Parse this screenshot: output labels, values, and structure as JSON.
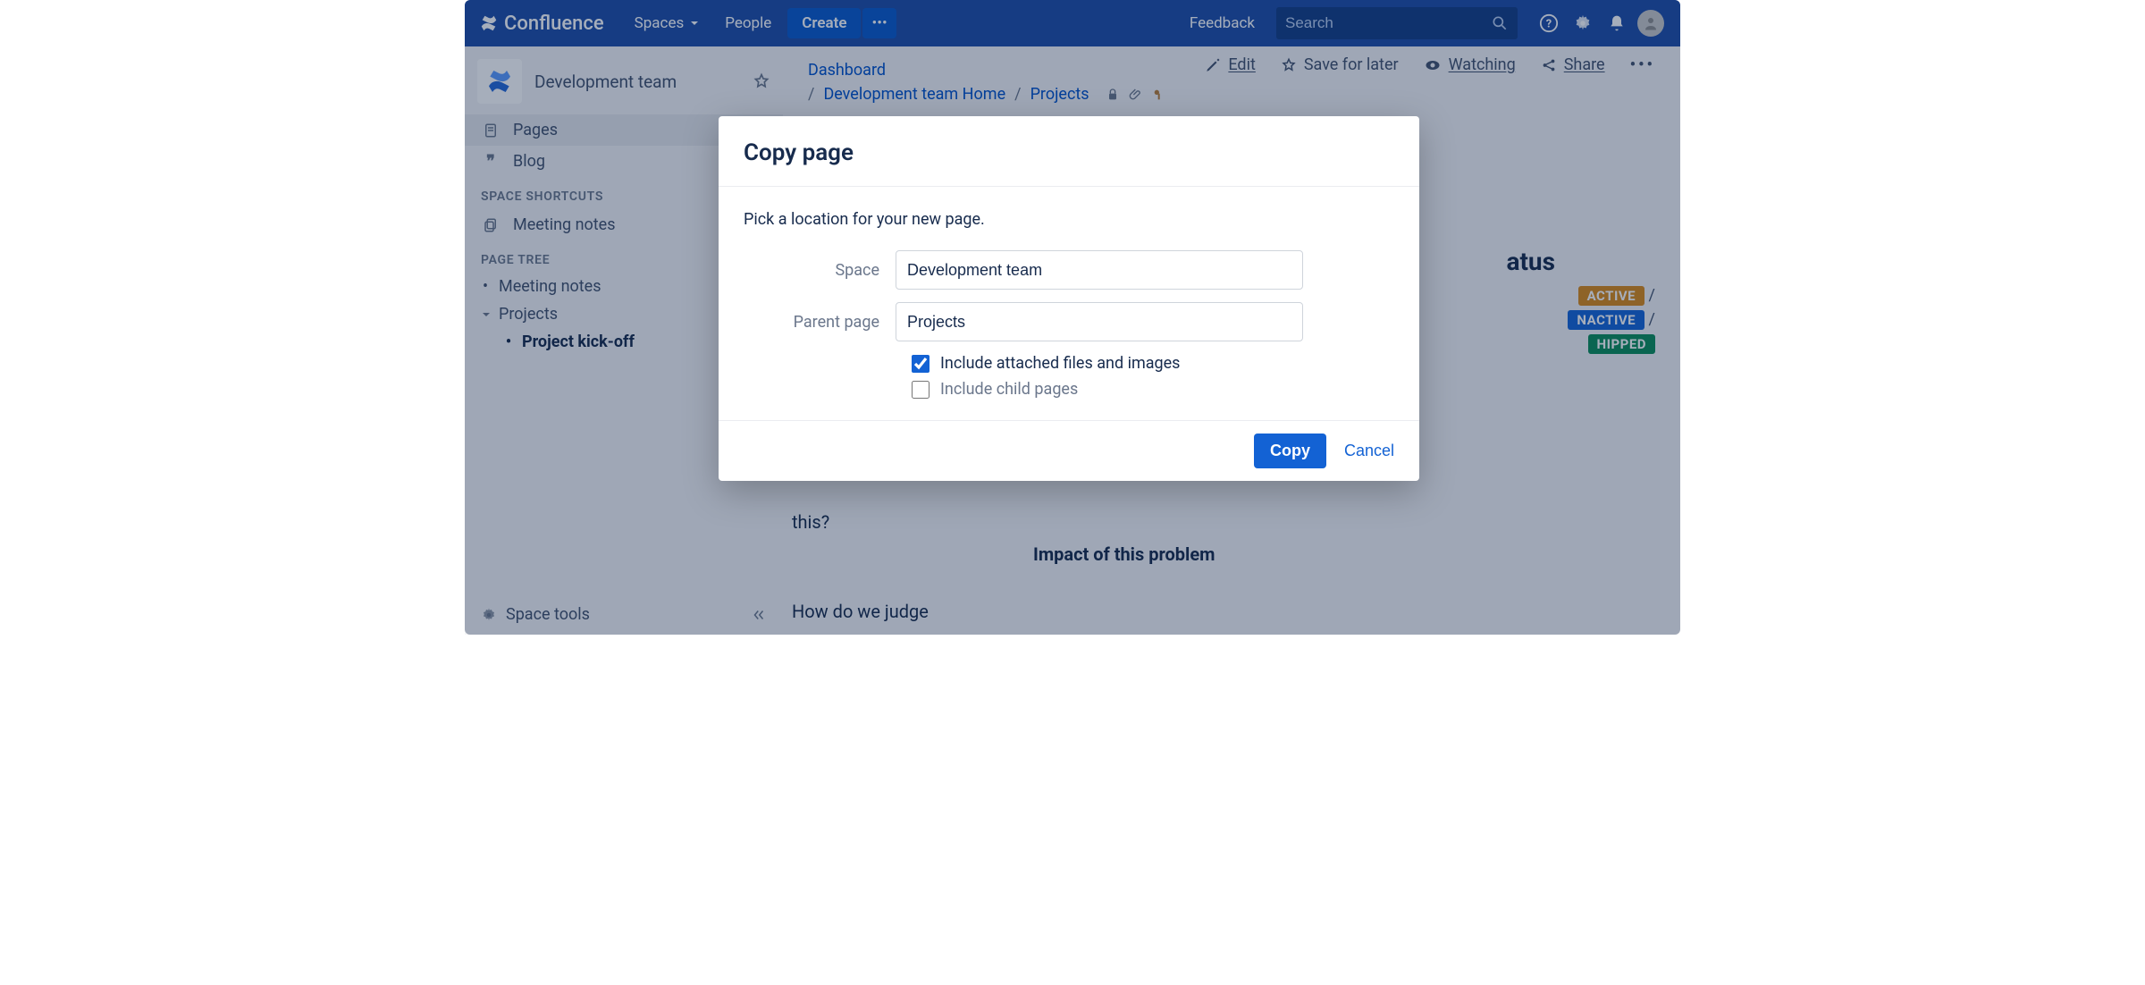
{
  "topbar": {
    "brand": "Confluence",
    "spaces": "Spaces",
    "people": "People",
    "create": "Create",
    "feedback": "Feedback",
    "search_placeholder": "Search"
  },
  "sidebar": {
    "space_name": "Development team",
    "pages": "Pages",
    "blog": "Blog",
    "shortcuts_label": "SPACE SHORTCUTS",
    "meeting_notes": "Meeting notes",
    "page_tree_label": "PAGE TREE",
    "tree": {
      "meeting_notes": "Meeting notes",
      "projects": "Projects",
      "project_kickoff": "Project kick-off"
    },
    "space_tools": "Space tools"
  },
  "breadcrumbs": {
    "dashboard": "Dashboard",
    "space_home": "Development team Home",
    "projects": "Projects"
  },
  "page_actions": {
    "edit": "Edit",
    "save_for_later": "Save for later",
    "watching": "Watching",
    "share": "Share"
  },
  "page": {
    "status_heading": "atus",
    "badges": {
      "active": "ACTIVE",
      "inactive": "NACTIVE",
      "shipped": "HIPPED"
    },
    "cell_this": "this?",
    "cell_impact": "Impact of this problem",
    "cell_judge": "How do we judge"
  },
  "modal": {
    "title": "Copy page",
    "desc": "Pick a location for your new page.",
    "space_label": "Space",
    "space_value": "Development team",
    "parent_label": "Parent page",
    "parent_value": "Projects",
    "include_attach": "Include attached files and images",
    "include_children": "Include child pages",
    "copy": "Copy",
    "cancel": "Cancel"
  }
}
